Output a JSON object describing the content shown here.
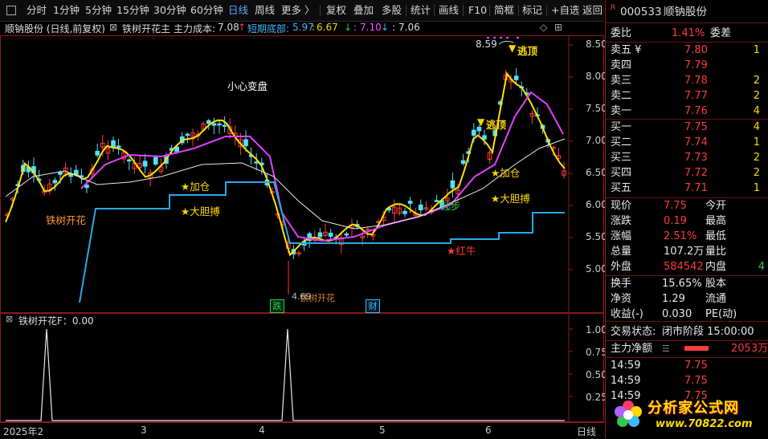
{
  "toolbar": {
    "items": [
      "分时",
      "1分钟",
      "5分钟",
      "15分钟",
      "30分钟",
      "60分钟",
      "日线",
      "周线",
      "更多 〉",
      "复权",
      "叠加",
      "多股",
      "统计",
      "画线",
      "F10",
      "简框",
      "标记",
      "+自选",
      "返回"
    ],
    "active": "日线"
  },
  "info": {
    "stock": "顺钠股份 (日线,前复权)",
    "indicator": "铁树开花主",
    "main_cost_label": "主力成本:",
    "main_cost": "7.08",
    "short_bottom_label": "短期底部:",
    "v1": "5.97",
    "v2": "6.67",
    "v3": "7.10",
    "v4": "7.06"
  },
  "chart_annotations": {
    "top_price": "8.59",
    "escape_top_1": "逃顶",
    "escape_top_2": "逃顶",
    "caution": "小心变盘",
    "add_pos_1": "★加仓",
    "add_pos_2": "★加仓",
    "bold_1": "★大胆搏",
    "bold_2": "★大胆搏",
    "tree_flower": "铁树开花",
    "red_bull": "★红牛",
    "start": "起步",
    "low_price": "4.69",
    "fall_tag": "跌",
    "money_tag": "财",
    "overlap_text": "铁树开花"
  },
  "price_axis": [
    "8.50",
    "8.00",
    "7.50",
    "7.00",
    "6.50",
    "6.00",
    "5.50",
    "5.00"
  ],
  "sub_indicator": {
    "label": "铁树开花F：0.00",
    "axis": [
      "1.00",
      "0.75",
      "0.50",
      "0.25"
    ]
  },
  "xaxis": {
    "labels": [
      "2025年2",
      "3",
      "4",
      "5",
      "6"
    ],
    "period": "日线"
  },
  "quote": {
    "code": "000533",
    "name": "顺钠股份",
    "wb_label": "委比",
    "wb_value": "1.41%",
    "wc_label": "委差",
    "asks": [
      {
        "label": "卖五 ¥",
        "price": "7.80",
        "vol": "1"
      },
      {
        "label": "卖四",
        "price": "7.79",
        "vol": ""
      },
      {
        "label": "卖三",
        "price": "7.78",
        "vol": "2"
      },
      {
        "label": "卖二",
        "price": "7.77",
        "vol": "2"
      },
      {
        "label": "卖一",
        "price": "7.76",
        "vol": "4"
      }
    ],
    "bids": [
      {
        "label": "买一",
        "price": "7.75",
        "vol": "4"
      },
      {
        "label": "买二",
        "price": "7.74",
        "vol": "1"
      },
      {
        "label": "买三",
        "price": "7.73",
        "vol": "2"
      },
      {
        "label": "买四",
        "price": "7.72",
        "vol": "2"
      },
      {
        "label": "买五",
        "price": "7.71",
        "vol": "1"
      }
    ],
    "stats": [
      {
        "l1": "现价",
        "v1": "7.75",
        "c1": "red",
        "l2": "今开",
        "v2": ""
      },
      {
        "l1": "涨跌",
        "v1": "0.19",
        "c1": "red",
        "l2": "最高",
        "v2": ""
      },
      {
        "l1": "涨幅",
        "v1": "2.51%",
        "c1": "red",
        "l2": "最低",
        "v2": ""
      },
      {
        "l1": "总量",
        "v1": "107.2万",
        "c1": "white",
        "l2": "量比",
        "v2": ""
      },
      {
        "l1": "外盘",
        "v1": "584542",
        "c1": "red",
        "l2": "内盘",
        "v2": "4"
      }
    ],
    "stats2": [
      {
        "l1": "换手",
        "v1": "15.65%",
        "l2": "股本"
      },
      {
        "l1": "净资",
        "v1": "1.29",
        "l2": "流通"
      },
      {
        "l1": "收益(-)",
        "v1": "0.030",
        "l2": "PE(动)"
      }
    ],
    "trade_state_label": "交易状态:",
    "trade_state": "闭市阶段 15:00:00",
    "net_flow_label": "主力净额",
    "net_flow": "2053万",
    "ticks": [
      {
        "time": "14:59",
        "price": "7.75"
      },
      {
        "time": "14:59",
        "price": "7.75"
      },
      {
        "time": "14:59",
        "price": "7.75"
      }
    ]
  },
  "logo": {
    "title": "分析家公式网",
    "url": "www.70822.com"
  }
}
